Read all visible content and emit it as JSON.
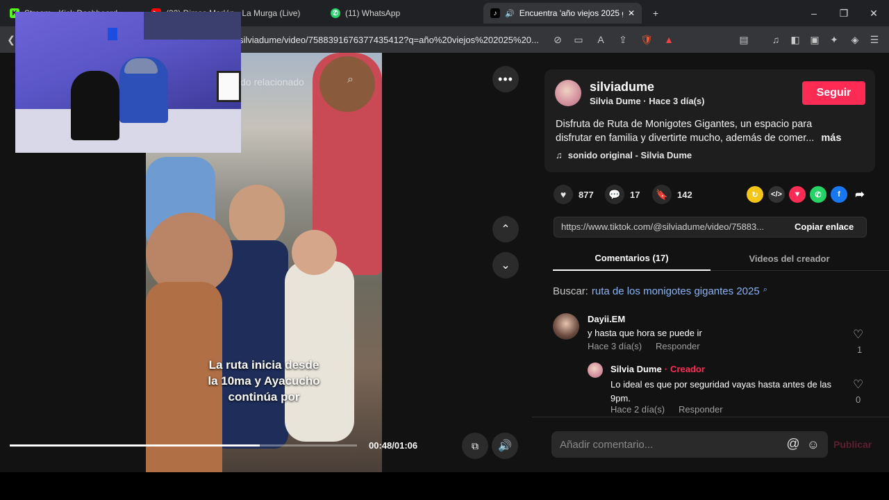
{
  "browser": {
    "tabs": [
      {
        "label": "Stream - Kick Dashboard",
        "active": false
      },
      {
        "label": "(32) Dimas Marlón - La Murga (Live)",
        "active": false
      },
      {
        "label": "(11) WhatsApp",
        "active": false
      },
      {
        "label": "Encuentra 'año viejos 2025 g",
        "active": true
      }
    ],
    "new_tab": "+",
    "url": "silviadume/video/7588391676377435412?q=año%20viejos%202025%20...",
    "window_controls": [
      "–",
      "❐",
      "✕"
    ]
  },
  "video": {
    "search_overlay": "do relacionado",
    "caption_lines": [
      "La ruta inicia desde",
      "la 10ma y Ayacucho",
      "continúa por"
    ],
    "time": "00:48/01:06",
    "progress": 0.72
  },
  "panel": {
    "username": "silviadume",
    "subtitle": "Silvia Dume · Hace 3 día(s)",
    "follow": "Seguir",
    "description_1": "Disfruta de Ruta de Monigotes Gigantes, un espacio para",
    "description_2": "disfrutar en familia y divertirte mucho, además de comer...",
    "more": "más",
    "sound": "sonido original - Silvia Dume",
    "likes": "877",
    "comments": "17",
    "saves": "142",
    "link": "https://www.tiktok.com/@silviadume/video/75883...",
    "copy": "Copiar enlace",
    "tab_comments": "Comentarios (17)",
    "tab_videos": "Videos del creador",
    "search_label": "Buscar:",
    "search_query": "ruta de los monigotes gigantes 2025",
    "add_comment": "Añadir comentario...",
    "publish": "Publicar"
  },
  "comments": [
    {
      "user": "Dayii.EM",
      "text": "y hasta que hora se puede ir",
      "time": "Hace 3 día(s)",
      "reply": "Responder",
      "likes": "1"
    },
    {
      "user": "Silvia Dume",
      "badge": "Creador",
      "text_1": "Lo ideal es que por seguridad vayas hasta antes de las",
      "text_2": "9pm.",
      "time": "Hace 2 día(s)",
      "reply": "Responder",
      "likes": "0"
    }
  ],
  "colors": {
    "accent": "#fe2c55",
    "link": "#8ab4f8",
    "bg": "#121212"
  }
}
